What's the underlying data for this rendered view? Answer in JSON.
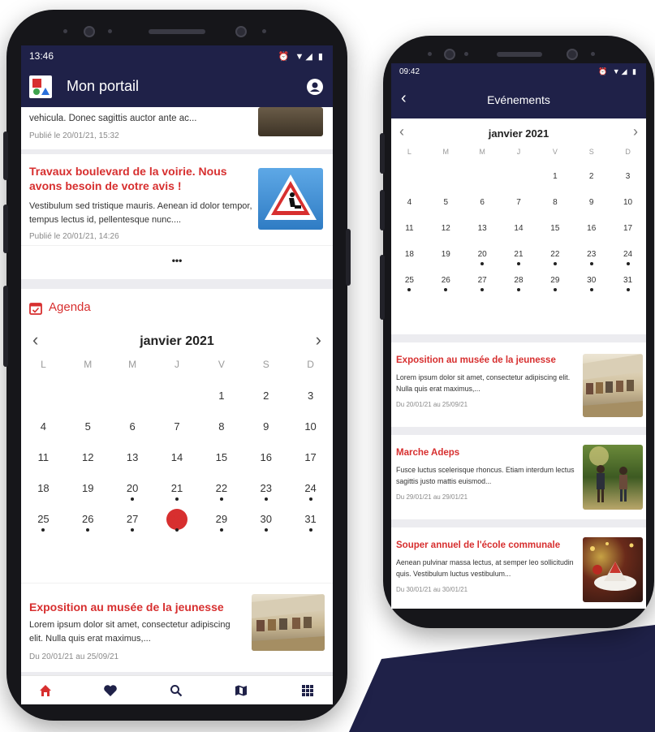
{
  "colors": {
    "primary_dark": "#1f2148",
    "accent_red": "#d72f2f",
    "shape_navy": "#1f2148"
  },
  "left_phone": {
    "status": {
      "time": "13:46",
      "icons": "⏰ ▼◢ ▮"
    },
    "appbar": {
      "title": "Mon portail",
      "logo": "app-logo",
      "profile_icon": "account-circle-icon"
    },
    "partial_card": {
      "desc": "vehicula. Donec sagittis auctor ante ac...",
      "date": "Publié le 20/01/21, 15:32"
    },
    "news_card": {
      "title": "Travaux boulevard de la voirie. Nous avons besoin de votre avis !",
      "desc": "Vestibulum sed tristique mauris. Aenean id dolor tempor, tempus lectus id, pellentesque nunc....",
      "date": "Publié le 20/01/21, 14:26"
    },
    "more_label": "•••",
    "agenda": {
      "title": "Agenda",
      "month": "janvier 2021",
      "prev": "‹",
      "next": "›",
      "dows": [
        "L",
        "M",
        "M",
        "J",
        "V",
        "S",
        "D"
      ],
      "weeks": [
        [
          "",
          "",
          "",
          "",
          "1",
          "2",
          "3"
        ],
        [
          "4",
          "5",
          "6",
          "7",
          "8",
          "9",
          "10"
        ],
        [
          "11",
          "12",
          "13",
          "14",
          "15",
          "16",
          "17"
        ],
        [
          "18",
          "19",
          "20",
          "21",
          "22",
          "23",
          "24"
        ],
        [
          "25",
          "26",
          "27",
          "28",
          "29",
          "30",
          "31"
        ]
      ],
      "event_days": [
        "20",
        "21",
        "22",
        "23",
        "24",
        "25",
        "26",
        "27",
        "28",
        "29",
        "30",
        "31"
      ],
      "selected_day": "28"
    },
    "event_card": {
      "title": "Exposition au musée de la jeunesse",
      "desc": "Lorem ipsum dolor sit amet, consectetur adipiscing elit. Nulla quis erat maximus,...",
      "date": "Du 20/01/21  au  25/09/21"
    },
    "navbar": [
      "home-icon",
      "heart-icon",
      "search-icon",
      "map-icon",
      "grid-icon"
    ]
  },
  "right_phone": {
    "status": {
      "time": "09:42",
      "icons": "⏰ ▼◢ ▮"
    },
    "appbar": {
      "title": "Evénements",
      "back": "‹"
    },
    "calendar": {
      "month": "janvier 2021",
      "prev": "‹",
      "next": "›",
      "dows": [
        "L",
        "M",
        "M",
        "J",
        "V",
        "S",
        "D"
      ],
      "weeks": [
        [
          "",
          "",
          "",
          "",
          "1",
          "2",
          "3"
        ],
        [
          "4",
          "5",
          "6",
          "7",
          "8",
          "9",
          "10"
        ],
        [
          "11",
          "12",
          "13",
          "14",
          "15",
          "16",
          "17"
        ],
        [
          "18",
          "19",
          "20",
          "21",
          "22",
          "23",
          "24"
        ],
        [
          "25",
          "26",
          "27",
          "28",
          "29",
          "30",
          "31"
        ]
      ],
      "event_days": [
        "20",
        "21",
        "22",
        "23",
        "24",
        "25",
        "26",
        "27",
        "28",
        "29",
        "30",
        "31"
      ]
    },
    "events": [
      {
        "title": "Exposition au musée de la jeunesse",
        "desc": "Lorem ipsum dolor sit amet, consectetur adipiscing elit. Nulla quis erat maximus,...",
        "date": "Du 20/01/21  au  25/09/21"
      },
      {
        "title": "Marche Adeps",
        "desc": "Fusce luctus scelerisque rhoncus. Etiam interdum lectus sagittis justo mattis euismod...",
        "date": "Du 29/01/21  au  29/01/21"
      },
      {
        "title": "Souper annuel de l'école communale",
        "desc": "Aenean pulvinar massa lectus, at semper leo sollicitudin quis. Vestibulum luctus vestibulum...",
        "date": "Du 30/01/21  au  30/01/21"
      }
    ]
  }
}
